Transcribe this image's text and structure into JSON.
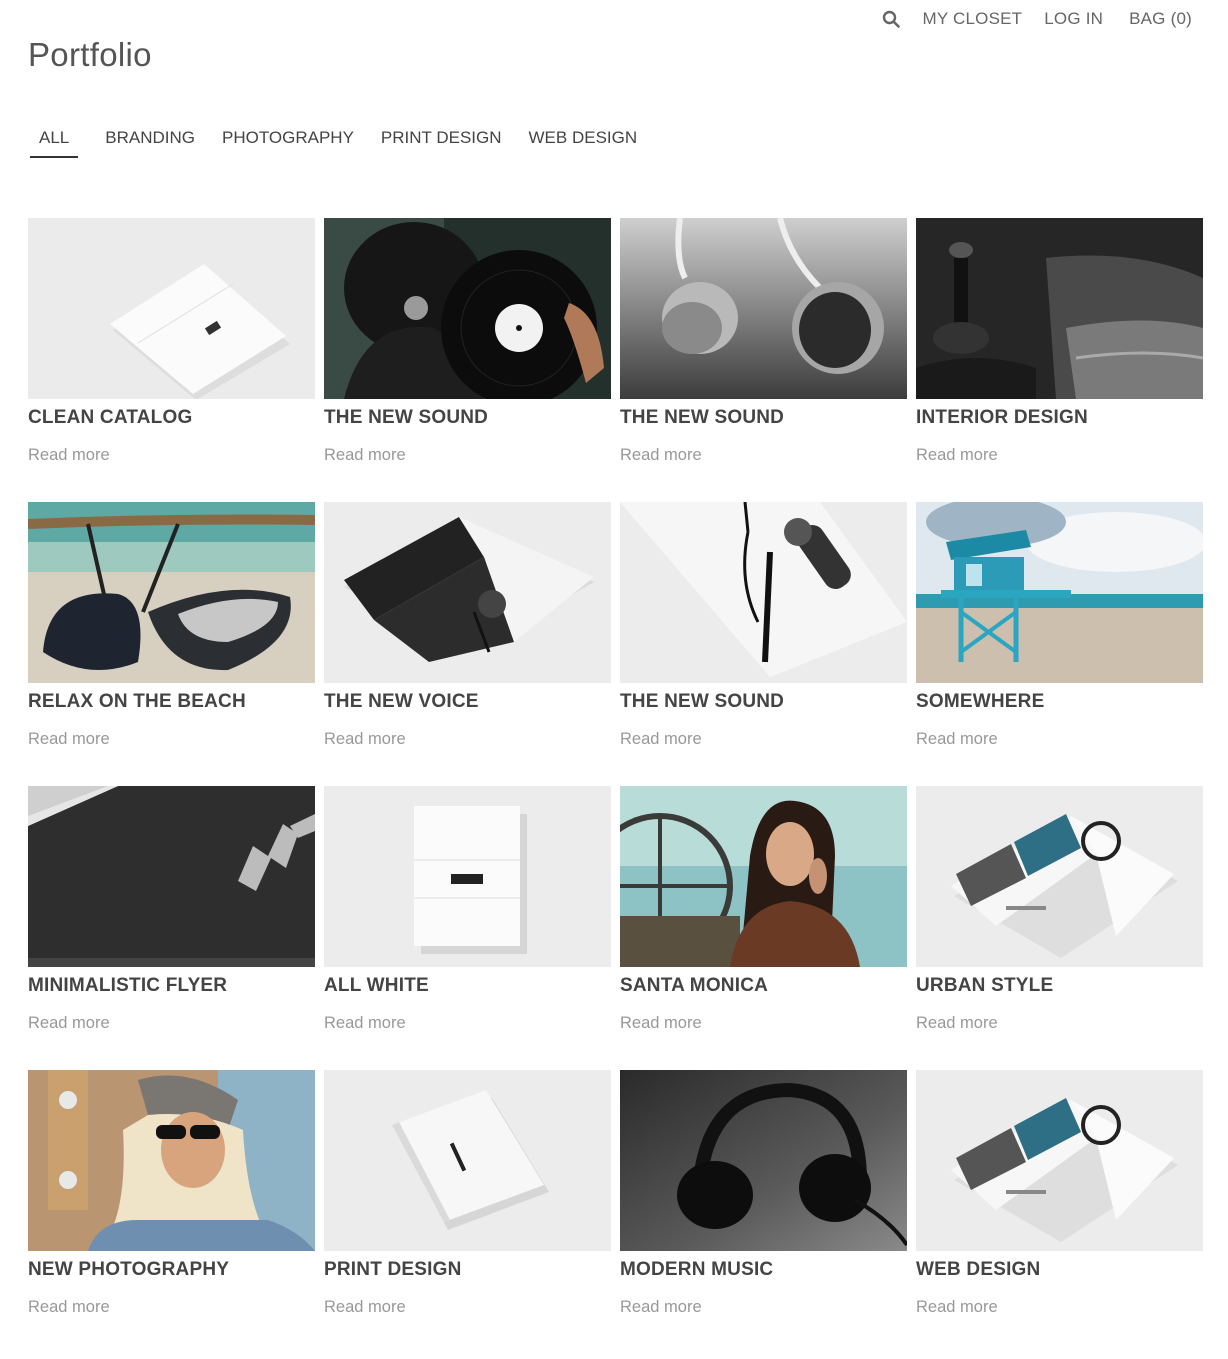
{
  "header": {
    "title": "Portfolio",
    "nav": {
      "my_closet": "MY CLOSET",
      "log_in": "LOG IN",
      "bag_label": "BAG",
      "bag_count": "(0)"
    }
  },
  "filters": [
    "ALL",
    "BRANDING",
    "PHOTOGRAPHY",
    "PRINT DESIGN",
    "WEB DESIGN"
  ],
  "read_more": "Read more",
  "items": [
    {
      "title": "CLEAN CATALOG"
    },
    {
      "title": "THE NEW SOUND"
    },
    {
      "title": "THE NEW SOUND"
    },
    {
      "title": "INTERIOR DESIGN"
    },
    {
      "title": "RELAX ON THE BEACH"
    },
    {
      "title": "THE NEW VOICE"
    },
    {
      "title": "THE NEW SOUND"
    },
    {
      "title": "SOMEWHERE"
    },
    {
      "title": "MINIMALISTIC FLYER"
    },
    {
      "title": "ALL WHITE"
    },
    {
      "title": "SANTA MONICA"
    },
    {
      "title": "URBAN STYLE"
    },
    {
      "title": "NEW PHOTOGRAPHY"
    },
    {
      "title": "PRINT DESIGN"
    },
    {
      "title": "MODERN MUSIC"
    },
    {
      "title": "WEB DESIGN"
    }
  ]
}
